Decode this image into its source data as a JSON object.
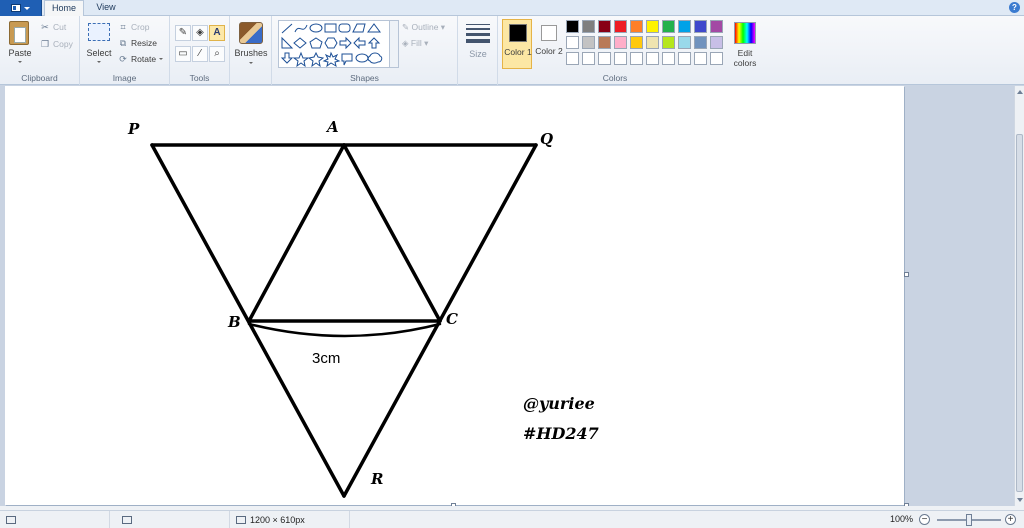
{
  "tabs": {
    "home": "Home",
    "view": "View",
    "help": "?"
  },
  "clipboard": {
    "paste": "Paste",
    "cut": "Cut",
    "copy": "Copy",
    "label": "Clipboard"
  },
  "image": {
    "select": "Select",
    "crop": "Crop",
    "resize": "Resize",
    "rotate": "Rotate",
    "label": "Image"
  },
  "tools": {
    "text_tool": "A",
    "label": "Tools"
  },
  "brushes": {
    "label": "Brushes"
  },
  "shapes": {
    "outline": "Outline",
    "fill": "Fill",
    "label": "Shapes"
  },
  "size": {
    "label": "Size"
  },
  "colors": {
    "color1_label": "Color 1",
    "color2_label": "Color 2",
    "edit_colors": "Edit colors",
    "label": "Colors",
    "palette": [
      "#000000",
      "#7f7f7f",
      "#880015",
      "#ed1c24",
      "#ff7f27",
      "#fff200",
      "#22b14c",
      "#00a2e8",
      "#3f48cc",
      "#a349a4",
      "#ffffff",
      "#c3c3c3",
      "#b97a57",
      "#ffaec9",
      "#ffc90e",
      "#efe4b0",
      "#b5e61d",
      "#99d9ea",
      "#7092be",
      "#c8bfe7",
      "#ffffff",
      "#ffffff",
      "#ffffff",
      "#ffffff",
      "#ffffff",
      "#ffffff",
      "#ffffff",
      "#ffffff",
      "#ffffff",
      "#ffffff"
    ],
    "color1": "#000000",
    "color2": "#ffffff"
  },
  "drawing": {
    "labels": {
      "P": "P",
      "A": "A",
      "Q": "Q",
      "B": "B",
      "C": "C",
      "R": "R"
    },
    "measurement": "3cm",
    "signature_line1": "@yuriee",
    "signature_line2": "#HD247"
  },
  "status": {
    "canvas_size": "1200 × 610px",
    "zoom": "100%",
    "zoom_level": 100
  }
}
